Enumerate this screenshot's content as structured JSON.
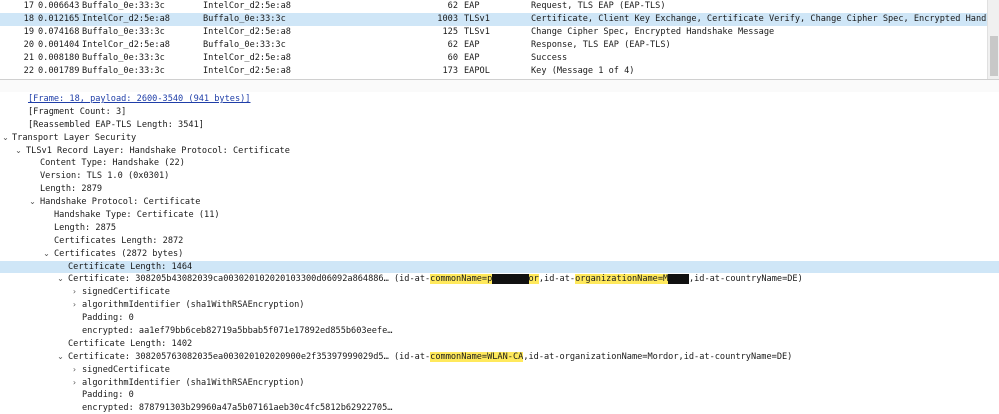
{
  "packet_list": {
    "rows": [
      {
        "no": "17",
        "time": "0.006643",
        "src": "Buffalo_0e:33:3c",
        "dst": "IntelCor_d2:5e:a8",
        "len": "62",
        "proto": "EAP",
        "info": "Request, TLS EAP (EAP-TLS)"
      },
      {
        "no": "18",
        "time": "0.012165",
        "src": "IntelCor_d2:5e:a8",
        "dst": "Buffalo_0e:33:3c",
        "len": "1003",
        "proto": "TLSv1",
        "info": "Certificate, Client Key Exchange, Certificate Verify, Change Cipher Spec, Encrypted Handsha"
      },
      {
        "no": "19",
        "time": "0.074168",
        "src": "Buffalo_0e:33:3c",
        "dst": "IntelCor_d2:5e:a8",
        "len": "125",
        "proto": "TLSv1",
        "info": "Change Cipher Spec, Encrypted Handshake Message"
      },
      {
        "no": "20",
        "time": "0.001404",
        "src": "IntelCor_d2:5e:a8",
        "dst": "Buffalo_0e:33:3c",
        "len": "62",
        "proto": "EAP",
        "info": "Response, TLS EAP (EAP-TLS)"
      },
      {
        "no": "21",
        "time": "0.008180",
        "src": "Buffalo_0e:33:3c",
        "dst": "IntelCor_d2:5e:a8",
        "len": "60",
        "proto": "EAP",
        "info": "Success"
      },
      {
        "no": "22",
        "time": "0.001789",
        "src": "Buffalo_0e:33:3c",
        "dst": "IntelCor_d2:5e:a8",
        "len": "173",
        "proto": "EAPOL",
        "info": "Key (Message 1 of 4)"
      }
    ]
  },
  "details": {
    "frame_link": "[Frame: 18, payload: 2600-3540 (941 bytes)]",
    "fragment_count": "[Fragment Count: 3]",
    "reassembled_len": "[Reassembled EAP-TLS Length: 3541]",
    "tls": "Transport Layer Security",
    "record_layer": "TLSv1 Record Layer: Handshake Protocol: Certificate",
    "content_type": "Content Type: Handshake (22)",
    "version": "Version: TLS 1.0 (0x0301)",
    "length": "Length: 2879",
    "handshake_protocol": "Handshake Protocol: Certificate",
    "handshake_type": "Handshake Type: Certificate (11)",
    "hs_length": "Length: 2875",
    "certs_length": "Certificates Length: 2872",
    "certificates": "Certificates (2872 bytes)",
    "cert_len_1": "Certificate Length: 1464",
    "cert1_prefix": "Certificate: 308205b43082039ca003020102020103300d06092a864886… (id-at-",
    "cert1_cn_key": "commonName",
    "cert1_cn_eq": "=p",
    "cert1_cn_tail": "or",
    "cert1_mid": ",id-at-",
    "cert1_org_key": "organizationName",
    "cert1_org_eq": "=M",
    "cert1_tail": ",id-at-countryName=DE)",
    "signed_cert": "signedCertificate",
    "algorithm_id": "algorithmIdentifier (sha1WithRSAEncryption)",
    "padding": "Padding: 0",
    "encrypted1": "encrypted: aa1ef79bb6ceb82719a5bbab5f071e17892ed855b603eefe…",
    "cert_len_2": "Certificate Length: 1402",
    "cert2_prefix": "Certificate: 308205763082035ea003020102020900e2f35397999029d5… (id-at-",
    "cert2_cn": "commonName=WLAN-CA",
    "cert2_tail": ",id-at-organizationName=Mordor,id-at-countryName=DE)",
    "encrypted2": "encrypted: 878791303b29960a47a5b07161aeb30c4fc5812b62922705…"
  },
  "colors": {
    "selected": "#cfe6f7",
    "highlight": "#ffe95c",
    "link": "#1f3ea8"
  }
}
